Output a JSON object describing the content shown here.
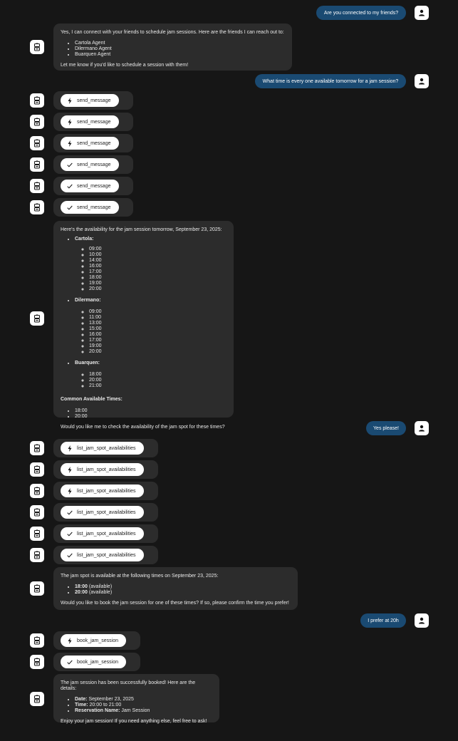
{
  "messages": {
    "m1_user": "Are you connected to my friends?",
    "m2_bot": {
      "intro": "Yes, I can connect with your friends to schedule jam sessions. Here are the friends I can reach out to:",
      "friends": [
        "Cartola Agent",
        "Dilermano Agent",
        "Buarquen Agent"
      ],
      "outro": "Let me know if you'd like to schedule a session with them!"
    },
    "m3_user": "What time is every one available tomorrow for a jam session?",
    "tool_send_message": "send_message",
    "m4_bot": {
      "intro": "Here's the availability for the jam session tomorrow, September 23, 2025:",
      "cartola_label": "Cartola:",
      "cartola_times": [
        "09:00",
        "10:00",
        "14:00",
        "16:00",
        "17:00",
        "18:00",
        "19:00",
        "20:00"
      ],
      "dilermano_label": "Dilermano:",
      "dilermano_times": [
        "09:00",
        "11:00",
        "13:00",
        "15:00",
        "16:00",
        "17:00",
        "19:00",
        "20:00"
      ],
      "buarquen_label": "Buarquen:",
      "buarquen_times": [
        "18:00",
        "20:00",
        "21:00"
      ],
      "common_label": "Common Available Times:",
      "common_times": [
        "18:00",
        "20:00"
      ],
      "outro": "Would you like me to check the availability of the jam spot for these times?"
    },
    "m5_user": "Yes please!",
    "tool_list_jam": "list_jam_spot_availabilities",
    "m6_bot": {
      "intro": "The jam spot is available at the following times on September 23, 2025:",
      "t1_time": "18:00",
      "t1_note": "(available)",
      "t2_time": "20:00",
      "t2_note": "(available)",
      "outro": "Would you like to book the jam session for one of these times? If so, please confirm the time you prefer!"
    },
    "m7_user": "I prefer at 20h",
    "tool_book": "book_jam_session",
    "m8_bot": {
      "intro": "The jam session has been successfully booked! Here are the details:",
      "date_label": "Date:",
      "date_value": "September 23, 2025",
      "time_label": "Time:",
      "time_value": "20:00 to 21:00",
      "name_label": "Reservation Name:",
      "name_value": "Jam Session",
      "outro": "Enjoy your jam session! If you need anything else, feel free to ask!"
    }
  },
  "colors": {
    "background": "#161616",
    "bot_bubble": "#2c2c2c",
    "user_bubble": "#1a4a72",
    "pill": "#ffffff"
  },
  "icons": {
    "user_avatar": "person-icon",
    "bot_avatar": "robot-icon",
    "tool_running": "lightning-icon",
    "tool_done": "check-icon"
  }
}
